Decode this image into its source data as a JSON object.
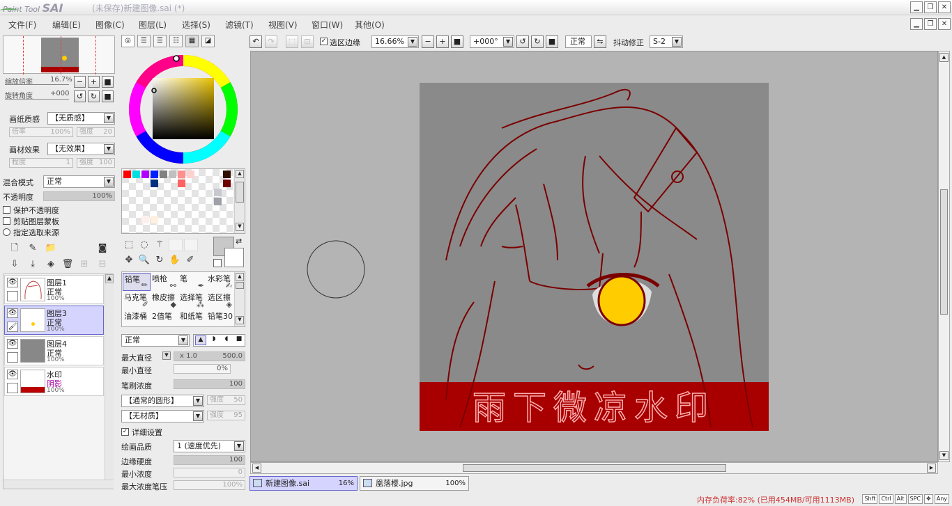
{
  "title": {
    "logo_small": "Paint Tool",
    "logo_big": "SAI",
    "window_title": "(未保存)新建图像.sai (*)"
  },
  "menu": [
    "文件(F)",
    "编辑(E)",
    "图像(C)",
    "图层(L)",
    "选择(S)",
    "滤镜(T)",
    "视图(V)",
    "窗口(W)",
    "其他(O)"
  ],
  "navigator": {
    "zoom_label": "缩放倍率",
    "zoom_value": "16.7%",
    "rotate_label": "旋转角度",
    "rotate_value": "+000"
  },
  "paper": {
    "texture_label": "画纸质感",
    "texture_value": "【无质感】",
    "scale_label": "倍率",
    "scale_value": "100%",
    "strength_label": "强度",
    "strength_value": "20",
    "effect_label": "画材效果",
    "effect_value": "【无效果】",
    "degree_label": "程度",
    "degree_value": "1",
    "effect_strength_label": "强度",
    "effect_strength_value": "100"
  },
  "layer_props": {
    "blend_label": "混合模式",
    "blend_value": "正常",
    "opacity_label": "不透明度",
    "opacity_value": "100%",
    "protect_opacity": "保护不透明度",
    "clip_mask": "剪贴图层蒙板",
    "sel_source": "指定选取来源"
  },
  "layers": [
    {
      "name": "图层1",
      "mode": "正常",
      "opacity": "100%",
      "selected": false
    },
    {
      "name": "图层3",
      "mode": "正常",
      "opacity": "100%",
      "selected": true
    },
    {
      "name": "图层4",
      "mode": "正常",
      "opacity": "100%",
      "selected": false
    },
    {
      "name": "水印",
      "mode": "阴影",
      "opacity": "100%",
      "selected": false
    }
  ],
  "swatch_colors": [
    "#ff0000",
    "#00e0e0",
    "#b000ff",
    "#0020ff",
    "#808080",
    "#c0c0c0",
    "#ff9090",
    "#ffd0d0",
    "#301000",
    "#003080",
    "#ff6060",
    "#700000",
    "#a0a0a8",
    "#c8c8d0",
    "#fff0f0",
    "#fff0e0"
  ],
  "brushes": [
    {
      "name": "铅笔",
      "icon": "pencil-icon"
    },
    {
      "name": "喷枪",
      "icon": "airbrush-icon"
    },
    {
      "name": "笔",
      "icon": "pen-icon"
    },
    {
      "name": "水彩笔",
      "icon": "watercolor-icon"
    },
    {
      "name": "马克笔",
      "icon": "marker-icon"
    },
    {
      "name": "橡皮擦",
      "icon": "eraser-icon"
    },
    {
      "name": "选择笔",
      "icon": "select-pen-icon"
    },
    {
      "name": "选区擦",
      "icon": "select-eraser-icon"
    },
    {
      "name": "油漆桶",
      "icon": "bucket-icon"
    },
    {
      "name": "2值笔",
      "icon": "binary-pen-icon"
    },
    {
      "name": "和纸笔",
      "icon": "washi-pen-icon"
    },
    {
      "name": "铅笔30",
      "icon": "pencil30-icon"
    }
  ],
  "brush_settings": {
    "mode_value": "正常",
    "max_size_label": "最大直径",
    "max_size_mult": "x 1.0",
    "max_size_value": "500.0",
    "min_size_label": "最小直径",
    "min_size_value": "0%",
    "density_label": "笔刷浓度",
    "density_value": "100",
    "shape_value": "【通常的圆形】",
    "shape_strength_label": "强度",
    "shape_strength_value": "50",
    "texture_value": "【无材质】",
    "texture_strength_label": "强度",
    "texture_strength_value": "95",
    "detail_label": "详细设置",
    "quality_label": "绘画品质",
    "quality_value": "1 (速度优先)",
    "edge_label": "边缘硬度",
    "edge_value": "100",
    "min_density_label": "最小浓度",
    "min_density_value": "0",
    "max_pressure_label": "最大浓度笔压",
    "max_pressure_value": "100%"
  },
  "topbar": {
    "sel_edge_label": "选区边缘",
    "zoom_value": "16.66%",
    "angle_value": "+000°",
    "mode_value": "正常",
    "stabilizer_label": "抖动修正",
    "stabilizer_value": "S-2"
  },
  "canvas": {
    "watermark_text": "雨下微凉水印"
  },
  "doc_tabs": [
    {
      "name": "新建图像.sai",
      "zoom": "16%",
      "active": true
    },
    {
      "name": "凰落樱.jpg",
      "zoom": "100%",
      "active": false
    }
  ],
  "status": {
    "memory": "内存负荷率:82% (已用454MB/可用1113MB)",
    "keys": [
      "Shft",
      "Ctrl",
      "Alt",
      "SPC",
      "Any"
    ]
  }
}
